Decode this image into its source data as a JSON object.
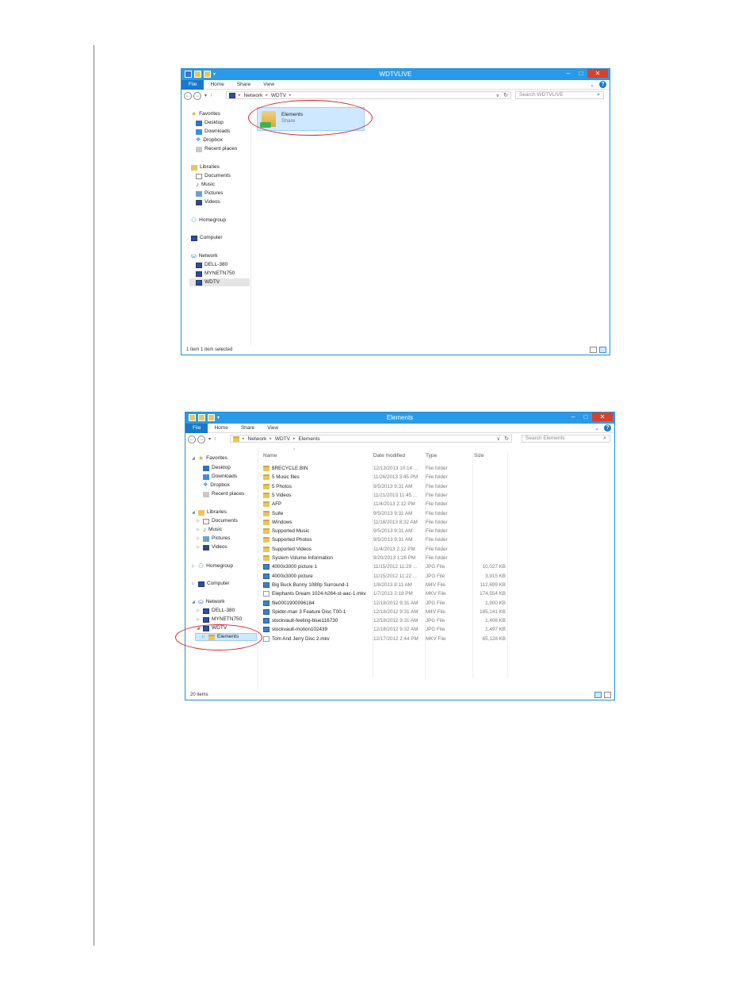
{
  "window1": {
    "title": "WDTVLIVE",
    "ribbon_tabs": [
      "File",
      "Home",
      "Share",
      "View"
    ],
    "address": [
      "Network",
      "WDTV"
    ],
    "search_placeholder": "Search WDTVLIVE",
    "nav": [
      {
        "label": "Favorites",
        "icon": "star"
      },
      {
        "label": "Desktop",
        "icon": "desk"
      },
      {
        "label": "Downloads",
        "icon": "dl"
      },
      {
        "label": "Dropbox",
        "icon": "drop"
      },
      {
        "label": "Recent places",
        "icon": "recent"
      },
      {
        "label": "Libraries",
        "icon": "lib"
      },
      {
        "label": "Documents",
        "icon": "doc"
      },
      {
        "label": "Music",
        "icon": "music"
      },
      {
        "label": "Pictures",
        "icon": "pic"
      },
      {
        "label": "Videos",
        "icon": "vid"
      },
      {
        "label": "Homegroup",
        "icon": "home"
      },
      {
        "label": "Computer",
        "icon": "comp"
      },
      {
        "label": "Network",
        "icon": "net"
      },
      {
        "label": "DELL-380",
        "icon": "comp"
      },
      {
        "label": "MYNETN750",
        "icon": "comp"
      },
      {
        "label": "WDTV",
        "icon": "comp"
      }
    ],
    "share_tile": {
      "name": "Elements",
      "subtitle": "Share"
    },
    "status": "1 item    1 item selected"
  },
  "window2": {
    "title": "Elements",
    "ribbon_tabs": [
      "File",
      "Home",
      "Share",
      "View"
    ],
    "address": [
      "Network",
      "WDTV",
      "Elements"
    ],
    "search_placeholder": "Search Elements",
    "nav": [
      {
        "label": "Favorites",
        "icon": "star"
      },
      {
        "label": "Desktop",
        "icon": "desk"
      },
      {
        "label": "Downloads",
        "icon": "dl"
      },
      {
        "label": "Dropbox",
        "icon": "drop"
      },
      {
        "label": "Recent places",
        "icon": "recent"
      },
      {
        "label": "Libraries",
        "icon": "lib"
      },
      {
        "label": "Documents",
        "icon": "doc"
      },
      {
        "label": "Music",
        "icon": "music"
      },
      {
        "label": "Pictures",
        "icon": "pic"
      },
      {
        "label": "Videos",
        "icon": "vid"
      },
      {
        "label": "Homegroup",
        "icon": "home"
      },
      {
        "label": "Computer",
        "icon": "comp"
      },
      {
        "label": "Network",
        "icon": "net"
      },
      {
        "label": "DELL-380",
        "icon": "comp"
      },
      {
        "label": "MYNETN750",
        "icon": "comp"
      },
      {
        "label": "WDTV",
        "icon": "comp"
      },
      {
        "label": "Elements",
        "icon": "folder"
      }
    ],
    "columns": [
      "Name",
      "Date modified",
      "Type",
      "Size"
    ],
    "rows": [
      {
        "name": "$RECYCLE.BIN",
        "date": "12/13/2013 10:14 ...",
        "type": "File folder",
        "size": "",
        "icon": "folder"
      },
      {
        "name": "5 Music files",
        "date": "11/26/2013 3:45 PM",
        "type": "File folder",
        "size": "",
        "icon": "folder"
      },
      {
        "name": "5 Photos",
        "date": "9/5/2013 9:31 AM",
        "type": "File folder",
        "size": "",
        "icon": "folder"
      },
      {
        "name": "5 Videos",
        "date": "11/21/2013 11:45 ...",
        "type": "File folder",
        "size": "",
        "icon": "folder"
      },
      {
        "name": "AFP",
        "date": "11/4/2013 2:12 PM",
        "type": "File folder",
        "size": "",
        "icon": "folder"
      },
      {
        "name": "Suite",
        "date": "9/5/2013 9:31 AM",
        "type": "File folder",
        "size": "",
        "icon": "folder"
      },
      {
        "name": "Windows",
        "date": "11/18/2013 8:32 AM",
        "type": "File folder",
        "size": "",
        "icon": "folder"
      },
      {
        "name": "Supported Music",
        "date": "9/5/2013 9:31 AM",
        "type": "File folder",
        "size": "",
        "icon": "folder"
      },
      {
        "name": "Supported Photos",
        "date": "9/5/2013 9:31 AM",
        "type": "File folder",
        "size": "",
        "icon": "folder"
      },
      {
        "name": "Supported Videos",
        "date": "11/4/2013 2:12 PM",
        "type": "File folder",
        "size": "",
        "icon": "folder"
      },
      {
        "name": "System Volume Information",
        "date": "9/20/2013 1:26 PM",
        "type": "File folder",
        "size": "",
        "icon": "folder"
      },
      {
        "name": "4000x3000 picture 1",
        "date": "11/15/2012 11:29 ...",
        "type": "JPG File",
        "size": "10,027 KB",
        "icon": "img"
      },
      {
        "name": "4000x3000 picture",
        "date": "11/15/2012 11:22 ...",
        "type": "JPG File",
        "size": "3,915 KB",
        "icon": "img"
      },
      {
        "name": "Big Buck Bunny 1080p Surround-1",
        "date": "1/8/2013 8:11 AM",
        "type": "M4V File",
        "size": "112,699 KB",
        "icon": "img"
      },
      {
        "name": "Elephants Dream 1024-h264-st-aac-1.mkv",
        "date": "1/7/2013 2:18 PM",
        "type": "MKV File",
        "size": "174,554 KB",
        "icon": "file"
      },
      {
        "name": "file0001900096184",
        "date": "12/18/2012 9:31 AM",
        "type": "JPG File",
        "size": "1,900 KB",
        "icon": "img"
      },
      {
        "name": "Spider-man 3 Feature Disc T00-1",
        "date": "12/18/2012 9:31 AM",
        "type": "M4V File",
        "size": "185,141 KB",
        "icon": "img"
      },
      {
        "name": "stockvault-feeling-blue116730",
        "date": "12/18/2012 9:31 AM",
        "type": "JPG File",
        "size": "1,406 KB",
        "icon": "img"
      },
      {
        "name": "stockvault-motion102439",
        "date": "12/18/2012 9:32 AM",
        "type": "JPG File",
        "size": "1,497 KB",
        "icon": "img"
      },
      {
        "name": "Tom And Jerry Disc 2.mkv",
        "date": "12/17/2012 2:44 PM",
        "type": "MKV File",
        "size": "65,128 KB",
        "icon": "file"
      }
    ],
    "status": "20 items"
  },
  "colors": {
    "titlebar": "#2b9ae6",
    "file_tab": "#1979ca",
    "close": "#d9402c",
    "highlight_oval": "#d8232a",
    "selection": "#cde8ff"
  }
}
